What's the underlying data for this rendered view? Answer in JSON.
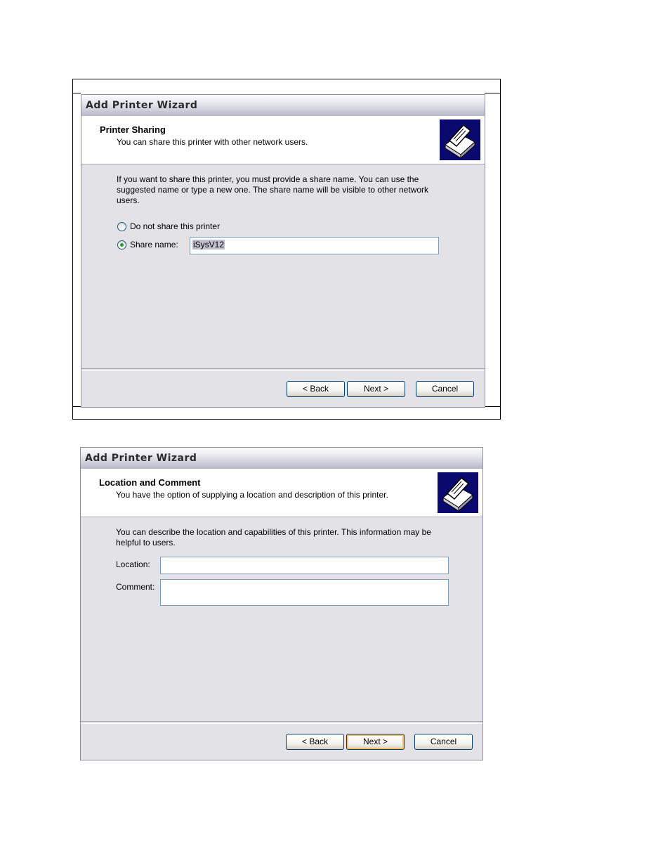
{
  "dialog1": {
    "title": "Add Printer Wizard",
    "header_title": "Printer Sharing",
    "header_subtitle": "You can share this printer with other network users.",
    "description": "If you want to share this printer, you must provide a share name. You can use the suggested name or type a new one. The share name will be visible to other network users.",
    "radio_no_share": "Do not share this printer",
    "radio_share": "Share name:",
    "share_name_value": "iSysV12",
    "selected_option": "Share name:",
    "back_label": "< Back",
    "next_label": "Next >",
    "cancel_label": "Cancel"
  },
  "dialog2": {
    "title": "Add Printer Wizard",
    "header_title": "Location and Comment",
    "header_subtitle": "You have the option of supplying a location and description of this printer.",
    "description": "You can describe the location and capabilities of this printer. This information may be helpful to users.",
    "location_label": "Location:",
    "location_value": "",
    "comment_label": "Comment:",
    "comment_value": "",
    "back_label": "< Back",
    "next_label": "Next >",
    "cancel_label": "Cancel"
  },
  "icons": {
    "header_icon": "printer-icon"
  },
  "colors": {
    "icon_background": "#0a0a6e",
    "dialog_background": "#e2e2e7",
    "default_button_highlight": "#f4c15e"
  }
}
